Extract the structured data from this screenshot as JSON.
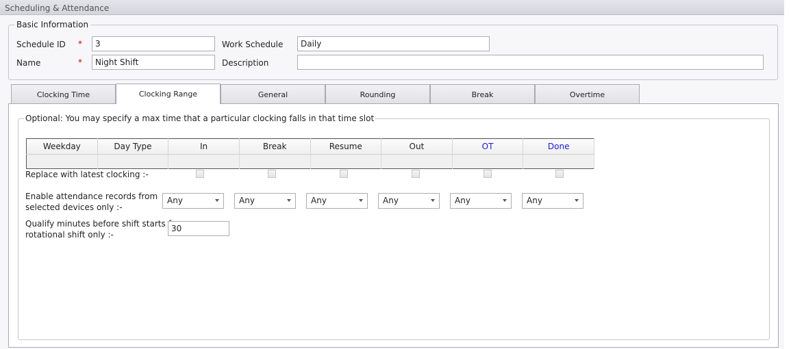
{
  "window": {
    "title": "Scheduling & Attendance"
  },
  "basic_info": {
    "legend": "Basic Information",
    "required_mark": "*",
    "schedule_id": {
      "label": "Schedule ID",
      "value": "3"
    },
    "name": {
      "label": "Name",
      "value": "Night Shift"
    },
    "work_schedule": {
      "label": "Work Schedule",
      "value": "Daily"
    },
    "description": {
      "label": "Description",
      "value": ""
    }
  },
  "tabs": [
    {
      "label": "Clocking Time",
      "active": false
    },
    {
      "label": "Clocking Range",
      "active": true
    },
    {
      "label": "General",
      "active": false
    },
    {
      "label": "Rounding",
      "active": false
    },
    {
      "label": "Break",
      "active": false
    },
    {
      "label": "Overtime",
      "active": false
    }
  ],
  "clocking_range": {
    "legend": "Optional: You may specify a max time that a particular clocking falls in that time slot",
    "columns": [
      "Weekday",
      "Day Type",
      "In",
      "Break",
      "Resume",
      "Out",
      "OT",
      "Done"
    ],
    "replace_label": "Replace with latest clocking :-",
    "devices_label_line1": "Enable attendance records from",
    "devices_label_line2": "selected devices only :-",
    "device_selects": [
      "Any",
      "Any",
      "Any",
      "Any",
      "Any",
      "Any"
    ],
    "qualify_label_line1": "Qualify minutes before shift starts for",
    "qualify_label_line2": "rotational shift only :-",
    "qualify_minutes": "30"
  },
  "colors": {
    "required": "#d00000",
    "header_blue": "#1a1acd"
  }
}
